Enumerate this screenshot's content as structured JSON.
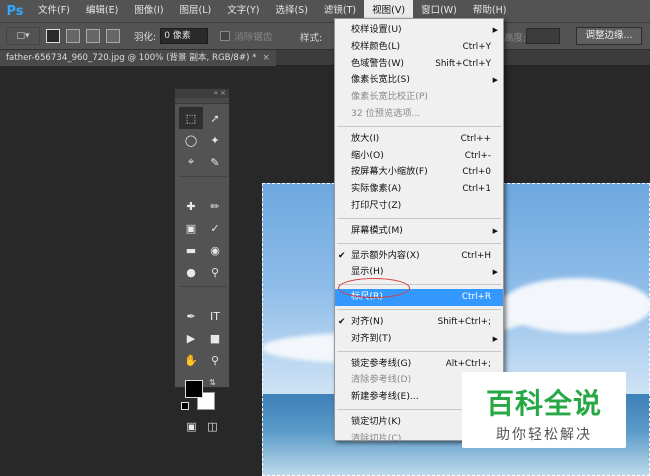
{
  "app": {
    "logo": "Ps",
    "menu": [
      {
        "label": "文件(F)"
      },
      {
        "label": "编辑(E)"
      },
      {
        "label": "图像(I)"
      },
      {
        "label": "图层(L)"
      },
      {
        "label": "文字(Y)"
      },
      {
        "label": "选择(S)"
      },
      {
        "label": "滤镜(T)"
      },
      {
        "label": "视图(V)"
      },
      {
        "label": "窗口(W)"
      },
      {
        "label": "帮助(H)"
      }
    ]
  },
  "options": {
    "feather_label": "羽化:",
    "feather_value": "0 像素",
    "antialias_label": "消除锯齿",
    "style_label": "样式:",
    "height_label": "高度:",
    "refine_edge": "调整边缘..."
  },
  "document": {
    "tab_title": "father-656734_960_720.jpg @ 100% (背景 副本, RGB/8#) *",
    "close": "×"
  },
  "tools_panel": {
    "header": "« ×"
  },
  "view_menu": {
    "items": [
      {
        "label": "校样设置(U)",
        "submenu": true
      },
      {
        "label": "校样颜色(L)",
        "shortcut": "Ctrl+Y"
      },
      {
        "label": "色域警告(W)",
        "shortcut": "Shift+Ctrl+Y"
      },
      {
        "label": "像素长宽比(S)",
        "submenu": true
      },
      {
        "label": "像素长宽比校正(P)",
        "disabled": true
      },
      {
        "label": "32 位预览选项...",
        "disabled": true
      },
      {
        "label": "放大(I)",
        "shortcut": "Ctrl++"
      },
      {
        "label": "缩小(O)",
        "shortcut": "Ctrl+-"
      },
      {
        "label": "按屏幕大小缩放(F)",
        "shortcut": "Ctrl+0"
      },
      {
        "label": "实际像素(A)",
        "shortcut": "Ctrl+1"
      },
      {
        "label": "打印尺寸(Z)"
      },
      {
        "label": "屏幕模式(M)",
        "submenu": true
      },
      {
        "label": "显示额外内容(X)",
        "shortcut": "Ctrl+H",
        "checked": true
      },
      {
        "label": "显示(H)",
        "submenu": true
      },
      {
        "label": "标尺(R)",
        "shortcut": "Ctrl+R",
        "highlighted": true
      },
      {
        "label": "对齐(N)",
        "shortcut": "Shift+Ctrl+;",
        "checked": true
      },
      {
        "label": "对齐到(T)",
        "submenu": true
      },
      {
        "label": "锁定参考线(G)",
        "shortcut": "Alt+Ctrl+;"
      },
      {
        "label": "清除参考线(D)",
        "disabled": true
      },
      {
        "label": "新建参考线(E)..."
      },
      {
        "label": "锁定切片(K)"
      },
      {
        "label": "清除切片(C)",
        "disabled": true
      }
    ]
  },
  "watermark": {
    "title": "百科全说",
    "subtitle": "助你轻松解决"
  },
  "colors": {
    "highlight": "#3399ff",
    "annotation_ring": "#d63b3b",
    "watermark_green": "#27a845"
  }
}
